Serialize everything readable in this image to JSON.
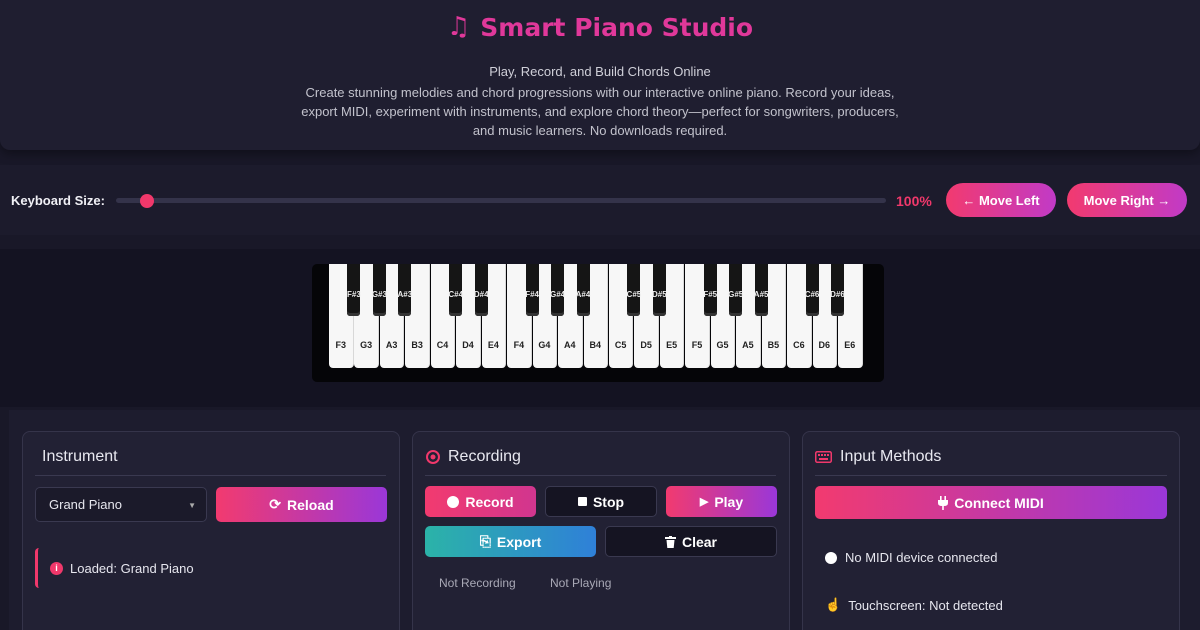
{
  "header": {
    "title": "Smart Piano Studio",
    "title_icon": "music-note-icon",
    "tagline": "Play, Record, and Build Chords Online",
    "description": "Create stunning melodies and chord progressions with our interactive online piano. Record your ideas, export MIDI, experiment with instruments, and explore chord theory—perfect for songwriters, producers, and music learners. No downloads required."
  },
  "keyboard_size": {
    "label": "Keyboard Size:",
    "value_text": "100%",
    "slider_level": 0.04,
    "move_left_label": "← Move Left",
    "move_right_label": "Move Right →"
  },
  "piano": {
    "white_keys": [
      "F3",
      "G3",
      "A3",
      "B3",
      "C4",
      "D4",
      "E4",
      "F4",
      "G4",
      "A4",
      "B4",
      "C5",
      "D5",
      "E5",
      "F5",
      "G5",
      "A5",
      "B5",
      "C6",
      "D6",
      "E6"
    ],
    "black_keys": [
      "F#3",
      "G#3",
      "A#3",
      "C#4",
      "D#4",
      "F#4",
      "G#4",
      "A#4",
      "C#5",
      "D#5",
      "F#5",
      "G#5",
      "A#5",
      "C#6",
      "D#6"
    ]
  },
  "instrument": {
    "title": "Instrument",
    "selected": "Grand Piano",
    "reload_label": "Reload",
    "status": "Loaded: Grand Piano"
  },
  "recording": {
    "title": "Recording",
    "record_label": "Record",
    "stop_label": "Stop",
    "play_label": "Play",
    "export_label": "Export",
    "clear_label": "Clear",
    "record_status": "Not Recording",
    "play_status": "Not Playing"
  },
  "input_methods": {
    "title": "Input Methods",
    "connect_label": "Connect MIDI",
    "midi_status": "No MIDI device connected",
    "touch_status": "Touchscreen: Not detected"
  },
  "colors": {
    "accent_pink": "#f0386b",
    "accent_purple": "#9a37d8",
    "title_magenta": "#e0389a",
    "teal": "#2bb3a8",
    "background": "#191828"
  }
}
